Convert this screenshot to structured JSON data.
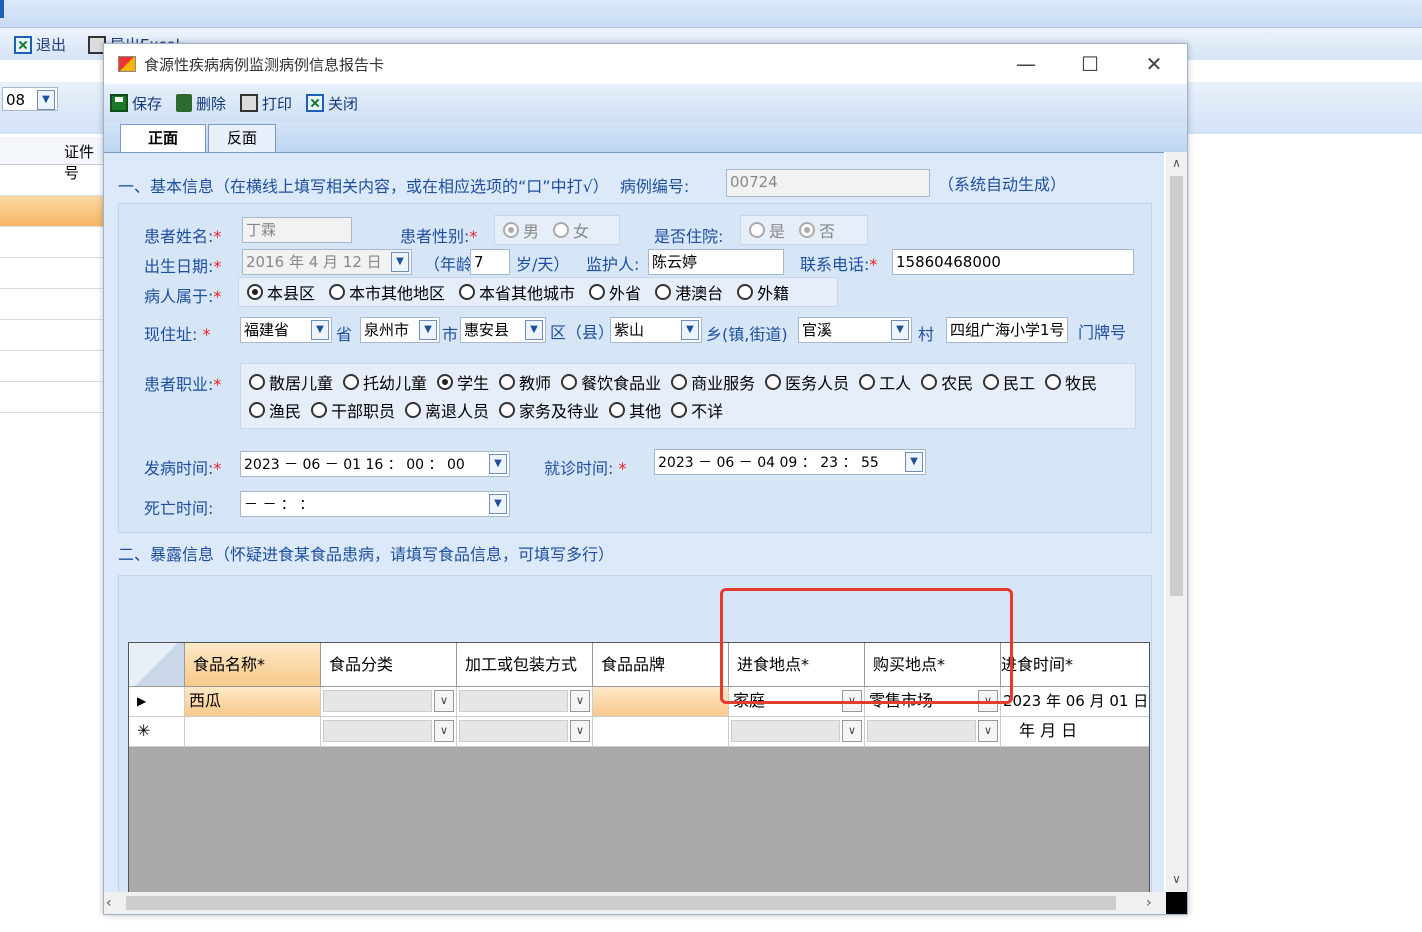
{
  "bg": {
    "toolbar": {
      "exit": "退出",
      "export": "导出Excel"
    },
    "combo_value": "08",
    "col_header": "证件号"
  },
  "dialog": {
    "title": "食源性疾病病例监测病例信息报告卡",
    "toolbar": {
      "save": "保存",
      "delete": "删除",
      "print": "打印",
      "close": "关闭"
    },
    "tabs": {
      "front": "正面",
      "back": "反面"
    },
    "section1": {
      "title": "一、基本信息（在横线上填写相关内容，或在相应选项的“口”中打√）",
      "case_no_label": "病例编号:",
      "case_no": "00724",
      "auto_note": "（系统自动生成）"
    },
    "patient": {
      "name_label": "患者姓名:",
      "name": "丁霖",
      "gender_label": "患者性别:",
      "gender_opts": [
        "男",
        "女"
      ],
      "hosp_label": "是否住院:",
      "hosp_opts": [
        "是",
        "否"
      ],
      "dob_label": "出生日期:",
      "dob": "2016 年 4 月 12 日",
      "age_label": "（年龄",
      "age": "7",
      "age_unit": "岁/天）",
      "guardian_label": "监护人:",
      "guardian": "陈云婷",
      "phone_label": "联系电话:",
      "phone": "15860468000",
      "belong_label": "病人属于:",
      "belong_opts": [
        "本县区",
        "本市其他地区",
        "本省其他城市",
        "外省",
        "港澳台",
        "外籍"
      ],
      "addr_label": "现住址:",
      "province": "福建省",
      "province_u": "省",
      "city": "泉州市",
      "city_u": "市",
      "county": "惠安县",
      "county_u": "区（县）",
      "town": "紫山",
      "town_u": "乡(镇,街道)",
      "village": "官溪",
      "village_u": "村",
      "street": "四组广海小学1号",
      "door_u": "门牌号",
      "job_label": "患者职业:",
      "job_opts1": [
        "散居儿童",
        "托幼儿童",
        "学生",
        "教师",
        "餐饮食品业",
        "商业服务",
        "医务人员",
        "工人",
        "农民",
        "民工"
      ],
      "job_opts2": [
        "牧民",
        "渔民",
        "干部职员",
        "离退人员",
        "家务及待业",
        "其他",
        "不详"
      ],
      "onset_label": "发病时间:",
      "onset": "2023 － 06 － 01    16 ： 00 ： 00",
      "visit_label": "就诊时间:",
      "visit": "2023 － 06 － 04    09 ： 23 ： 55",
      "death_label": "死亡时间:",
      "death": "   －   －          ：   ："
    },
    "section2": {
      "title": "二、暴露信息（怀疑进食某食品患病，请填写食品信息，可填写多行）"
    },
    "grid": {
      "headers": [
        "食品名称*",
        "食品分类",
        "加工或包装方式",
        "食品品牌",
        "进食地点*",
        "购买地点*",
        "进食时间*"
      ],
      "row1": {
        "food": "西瓜",
        "eat_place": "家庭",
        "buy_place": "零售市场",
        "eat_time": "2023 年 06 月 01 日"
      },
      "row2": {
        "eat_time": "  年   月   日"
      }
    }
  }
}
